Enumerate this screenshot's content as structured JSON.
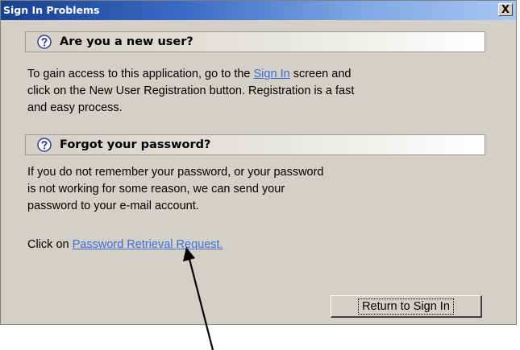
{
  "window": {
    "title": "Sign In Problems",
    "close_label": "X"
  },
  "section_new_user": {
    "heading": "Are you a new user?",
    "icon": "help-question-icon",
    "line1_before": "To gain access to this application, go to the ",
    "line1_link": "Sign In",
    "line1_after": " screen and",
    "line2": "click on the New User Registration button. Registration is a fast",
    "line3": "and easy process."
  },
  "section_forgot": {
    "heading": "Forgot your password?",
    "icon": "help-question-icon",
    "line1": "If you do not remember your password, or your password",
    "line2": "is not working for some reason, we can send your",
    "line3": "password to your e-mail account.",
    "click_prefix": "Click on ",
    "click_link": "Password Retrieval Request."
  },
  "buttons": {
    "return_label": "Return to Sign In"
  },
  "colors": {
    "link": "#3b6ed6",
    "titlebar_start": "#17408f",
    "titlebar_end": "#a7c6f2",
    "window_bg": "#d4d0c8"
  }
}
